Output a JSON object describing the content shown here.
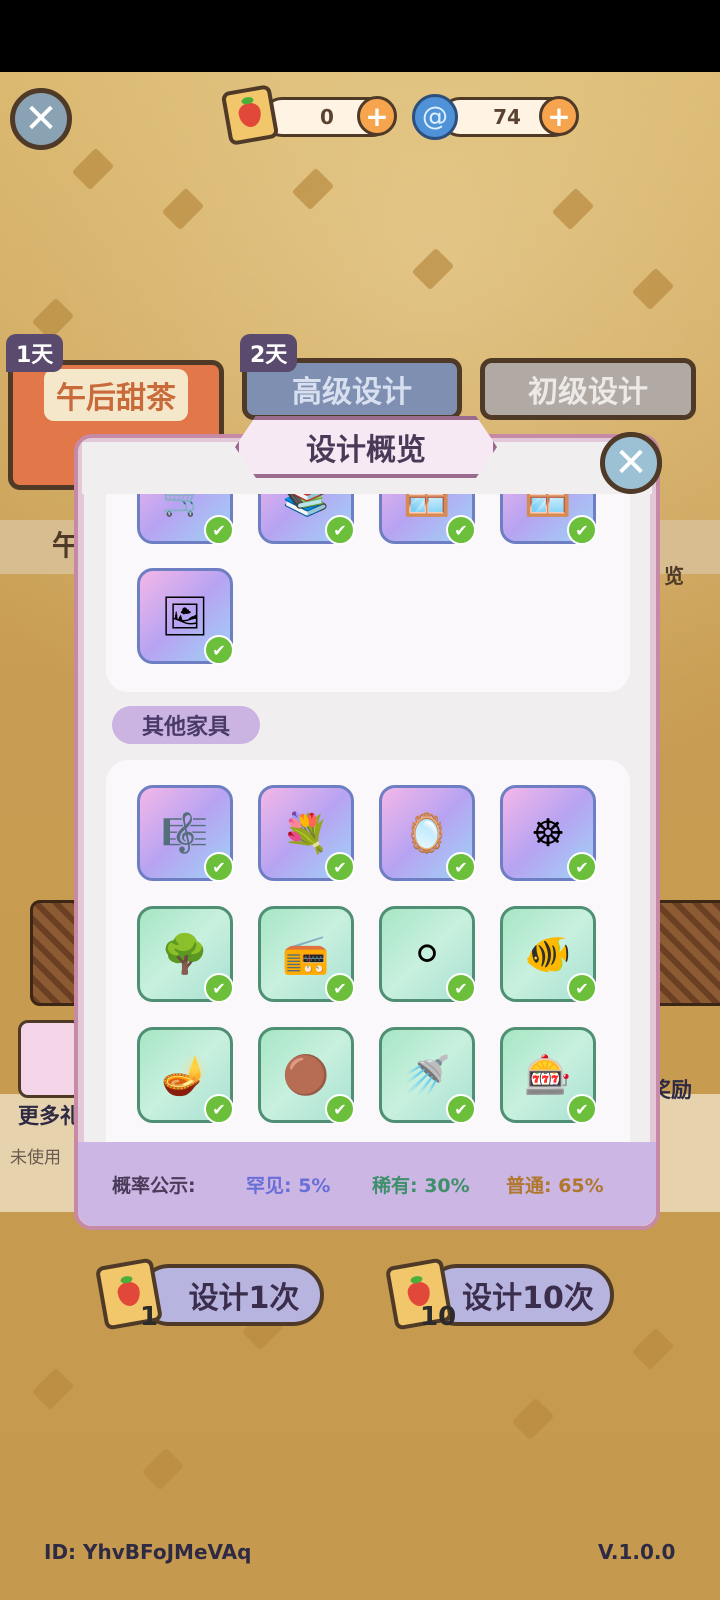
{
  "header": {
    "scroll_count": "0",
    "gem_count": "74",
    "plus_label": "+"
  },
  "tabs": [
    {
      "badge": "1天",
      "label": "午后甜茶"
    },
    {
      "badge": "2天",
      "label": "高级设计"
    },
    {
      "badge": "",
      "label": "初级设计"
    }
  ],
  "side_partial": {
    "left_text": "午",
    "right_text": "览",
    "more_text": "更多礼",
    "unused_text": "未使用",
    "reward_text": "奖励"
  },
  "modal": {
    "title": "设计概览",
    "section_other": "其他家具",
    "top_items": [
      {
        "icon": "cart-icon",
        "glyph": "🛒"
      },
      {
        "icon": "bookshelf-icon",
        "glyph": "📚"
      },
      {
        "icon": "window-icon",
        "glyph": "🪟"
      },
      {
        "icon": "window-icon",
        "glyph": "🪟"
      },
      {
        "icon": "painting-icon",
        "glyph": "🖼"
      }
    ],
    "rare_items": [
      {
        "icon": "harp-icon",
        "glyph": "🎼"
      },
      {
        "icon": "flower-vase-icon",
        "glyph": "💐"
      },
      {
        "icon": "mirror-icon",
        "glyph": "🪞"
      },
      {
        "icon": "spinning-wheel-icon",
        "glyph": "☸"
      }
    ],
    "uncommon_items": [
      {
        "icon": "orange-tree-icon",
        "glyph": "🌳"
      },
      {
        "icon": "radio-icon",
        "glyph": "📻"
      },
      {
        "icon": "robot-vacuum-icon",
        "glyph": "⚪"
      },
      {
        "icon": "aquarium-icon",
        "glyph": "🐠"
      },
      {
        "icon": "floor-lamp-icon",
        "glyph": "🪔"
      },
      {
        "icon": "round-rug-icon",
        "glyph": "🟤"
      },
      {
        "icon": "shower-icon",
        "glyph": "🚿"
      },
      {
        "icon": "claw-machine-icon",
        "glyph": "🎰"
      }
    ],
    "check_glyph": "✔",
    "probability": {
      "label": "概率公示:",
      "rare": "罕见: 5%",
      "uncommon": "稀有: 30%",
      "common": "普通: 65%",
      "rare_color": "#6a6fd8",
      "uncommon_color": "#3e8f6a",
      "common_color": "#b0782f"
    }
  },
  "buttons": {
    "design_once": "设计1次",
    "design_once_cost": "1",
    "design_ten": "设计10次",
    "design_ten_cost": "10"
  },
  "footer": {
    "id": "ID: YhvBFoJMeVAq",
    "version": "V.1.0.0"
  },
  "colors": {
    "close": "#8aa3b4",
    "accent_plus": "#f7a44e"
  }
}
